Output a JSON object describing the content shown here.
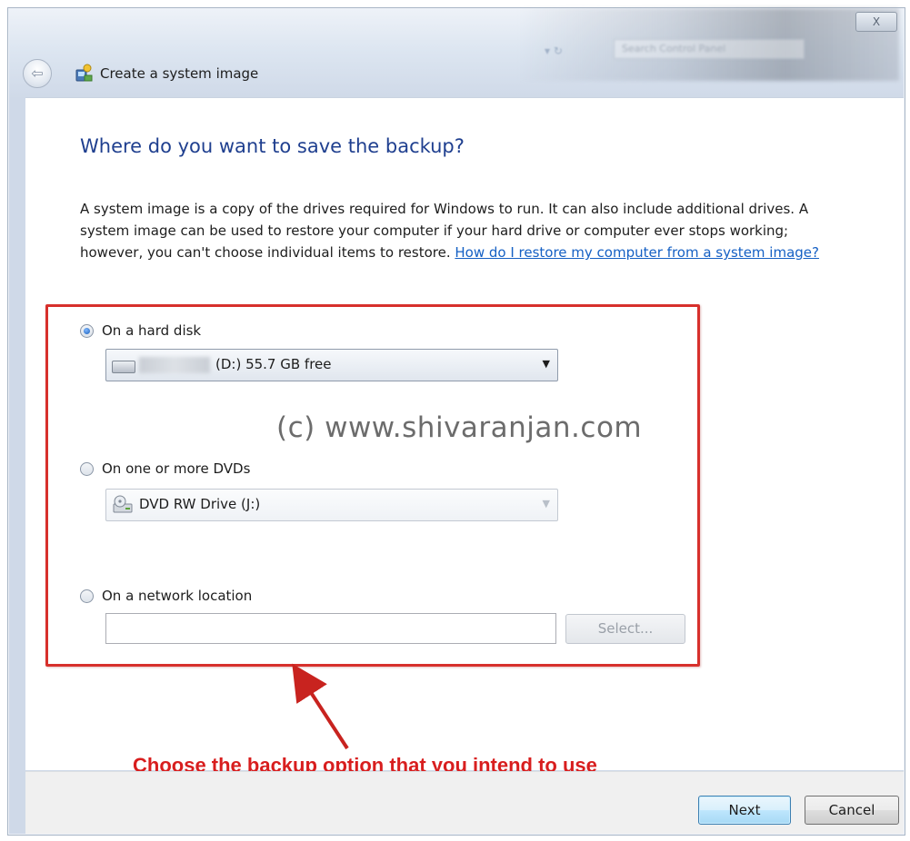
{
  "window": {
    "title": "Create a system image",
    "close_label": "X",
    "search_placeholder": "Search Control Panel"
  },
  "content": {
    "heading": "Where do you want to save the backup?",
    "description": "A system image is a copy of the drives required for Windows to run. It can also include additional drives. A system image can be used to restore your computer if your hard drive or computer ever stops working; however, you can't choose individual items to restore. ",
    "help_link": "How do I restore my computer from a system image?"
  },
  "options": {
    "hard_disk": {
      "label": "On a hard disk",
      "selected": true,
      "drive_value": "(D:)  55.7 GB free"
    },
    "dvd": {
      "label": "On one or more DVDs",
      "selected": false,
      "drive_value": "DVD RW Drive (J:)"
    },
    "network": {
      "label": "On a network location",
      "selected": false,
      "path_value": "",
      "select_button": "Select..."
    }
  },
  "watermark": "(c) www.shivaranjan.com",
  "annotation": "Choose the backup option that you intend to use",
  "footer": {
    "next_label": "Next",
    "cancel_label": "Cancel"
  },
  "colors": {
    "heading": "#1f3f8f",
    "link": "#1560c4",
    "highlight_border": "#d7302c",
    "annotation": "#d81e1e"
  }
}
